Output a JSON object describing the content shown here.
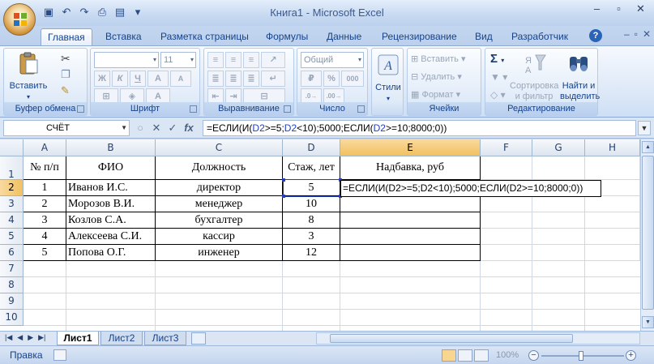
{
  "window": {
    "title": "Книга1 - Microsoft Excel",
    "qat": [
      "💾",
      "↶",
      "↷",
      "🖨",
      "⎙"
    ],
    "controls": [
      "–",
      "▫",
      "✕"
    ],
    "sub_controls": [
      "–",
      "▫",
      "✕"
    ],
    "help": "?"
  },
  "tabs": [
    "Главная",
    "Вставка",
    "Разметка страницы",
    "Формулы",
    "Данные",
    "Рецензирование",
    "Вид",
    "Разработчик"
  ],
  "ribbon": {
    "clipboard": {
      "label": "Буфер обмена",
      "paste": "Вставить"
    },
    "font": {
      "label": "Шрифт",
      "font_name": "",
      "font_size": "11",
      "bold": "Ж",
      "italic": "К",
      "underline": "Ч",
      "grow": "A",
      "shrink": "A"
    },
    "alignment": {
      "label": "Выравнивание"
    },
    "number": {
      "label": "Число",
      "format": "Общий",
      "pct": "%",
      "thousands": "000"
    },
    "styles": {
      "label": "Стили"
    },
    "cells": {
      "label": "Ячейки",
      "insert": "Вставить",
      "delete": "Удалить",
      "format": "Формат"
    },
    "editing": {
      "label": "Редактирование",
      "sum": "Σ",
      "sort": "Сортировка\nи фильтр",
      "find": "Найти и\nвыделить"
    }
  },
  "formula_bar": {
    "name_box": "СЧЁТ",
    "formula_parts": [
      {
        "t": "=ЕСЛИ(И(",
        "c": "#000000"
      },
      {
        "t": "D2",
        "c": "#1f3fbf"
      },
      {
        "t": ">=5;",
        "c": "#000000"
      },
      {
        "t": "D2",
        "c": "#1f3fbf"
      },
      {
        "t": "<10);5000;ЕСЛИ(",
        "c": "#000000"
      },
      {
        "t": "D2",
        "c": "#1f3fbf"
      },
      {
        "t": ">=10;8000;0))",
        "c": "#000000"
      }
    ]
  },
  "sheet": {
    "columns": [
      "A",
      "B",
      "C",
      "D",
      "E",
      "F",
      "G",
      "H"
    ],
    "rows": [
      "1",
      "2",
      "3",
      "4",
      "5",
      "6",
      "7",
      "8",
      "9",
      "10"
    ],
    "headers": [
      "№ п/п",
      "ФИО",
      "Должность",
      "Стаж, лет",
      "Надбавка, руб"
    ],
    "data": [
      [
        "1",
        "Иванов И.С.",
        "директор",
        "5"
      ],
      [
        "2",
        "Морозов В.И.",
        "менеджер",
        "10"
      ],
      [
        "3",
        "Козлов С.А.",
        "бухгалтер",
        "8"
      ],
      [
        "4",
        "Алексеева С.И.",
        "кассир",
        "3"
      ],
      [
        "5",
        "Попова О.Г.",
        "инженер",
        "12"
      ]
    ],
    "editing_cell": "E2",
    "editing_text": "=ЕСЛИ(И(D2>=5;D2<10);5000;ЕСЛИ(D2>=10;8000;0))"
  },
  "sheet_tabs": [
    "Лист1",
    "Лист2",
    "Лист3"
  ],
  "status": {
    "mode": "Правка",
    "zoom": "100%"
  }
}
